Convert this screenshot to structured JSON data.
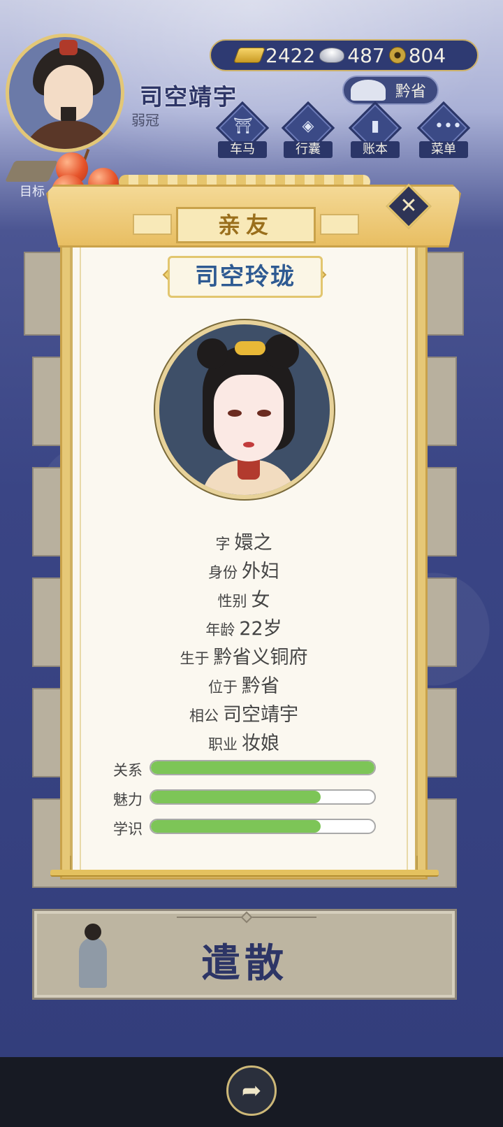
{
  "player": {
    "name": "司空靖宇",
    "rank": "弱冠"
  },
  "currencies": [
    {
      "icon": "gold-ingot-icon",
      "value": "2422"
    },
    {
      "icon": "silver-ingot-icon",
      "value": "487"
    },
    {
      "icon": "copper-coin-icon",
      "value": "804"
    }
  ],
  "location": "黔省",
  "nav": [
    {
      "label": "车马",
      "icon": "carriage-icon"
    },
    {
      "label": "行囊",
      "icon": "bag-icon"
    },
    {
      "label": "账本",
      "icon": "ledger-icon"
    },
    {
      "label": "菜单",
      "icon": "menu-icon"
    }
  ],
  "goal_label": "目标",
  "dismiss_label": "遣散",
  "modal": {
    "title": "亲友",
    "name": "司空玲珑",
    "info": [
      {
        "key": "字",
        "value": "嬛之"
      },
      {
        "key": "身份",
        "value": "外妇"
      },
      {
        "key": "性别",
        "value": "女"
      },
      {
        "key": "年龄",
        "value": "22岁"
      },
      {
        "key": "生于",
        "value": "黔省义铜府"
      },
      {
        "key": "位于",
        "value": "黔省"
      },
      {
        "key": "相公",
        "value": "司空靖宇"
      },
      {
        "key": "职业",
        "value": "妆娘"
      }
    ],
    "stats": [
      {
        "label": "关系",
        "level": 1.0
      },
      {
        "label": "魅力",
        "level": 0.76
      },
      {
        "label": "学识",
        "level": 0.76
      }
    ]
  },
  "colors": {
    "stat_fill": "#7dc557",
    "name_blue": "#2e5a92",
    "gold_frame": "#e6c877"
  }
}
